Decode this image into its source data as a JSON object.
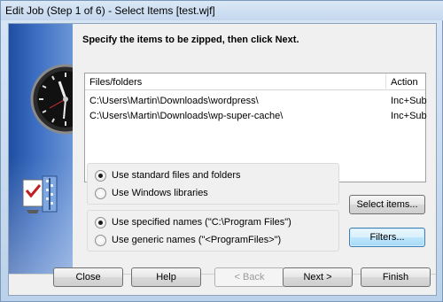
{
  "window": {
    "title": "Edit Job (Step 1 of 6) - Select Items [test.wjf]"
  },
  "instruction": "Specify the items to be zipped, then click Next.",
  "list": {
    "columns": [
      "Files/folders",
      "Action"
    ],
    "rows": [
      {
        "path": "C:\\Users\\Martin\\Downloads\\wordpress\\",
        "action": "Inc+Sub"
      },
      {
        "path": "C:\\Users\\Martin\\Downloads\\wp-super-cache\\",
        "action": "Inc+Sub"
      }
    ]
  },
  "source_options": {
    "selected": "standard",
    "items": [
      {
        "id": "standard",
        "label": "Use standard files and folders",
        "checked": true
      },
      {
        "id": "libraries",
        "label": "Use Windows libraries",
        "checked": false
      }
    ]
  },
  "name_options": {
    "selected": "specified",
    "items": [
      {
        "id": "specified",
        "label": "Use specified names (\"C:\\Program Files\")",
        "checked": true
      },
      {
        "id": "generic",
        "label": "Use generic names (\"<ProgramFiles>\")",
        "checked": false
      }
    ]
  },
  "buttons": {
    "select_items": "Select items...",
    "filters": "Filters...",
    "close": "Close",
    "help": "Help",
    "back": "< Back",
    "next": "Next >",
    "finish": "Finish"
  },
  "icons": {
    "clock": "clock-icon",
    "zip": "zip-wizard-icon"
  }
}
